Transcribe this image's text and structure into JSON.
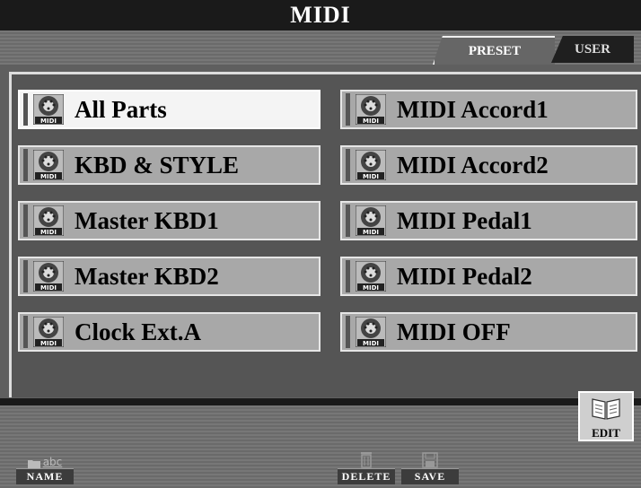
{
  "title": "MIDI",
  "tabs": [
    {
      "label": "PRESET",
      "active": true
    },
    {
      "label": "USER",
      "active": false
    }
  ],
  "items": [
    {
      "label": "All Parts",
      "selected": true,
      "icon": "midi-icon"
    },
    {
      "label": "KBD & STYLE",
      "selected": false,
      "icon": "midi-icon"
    },
    {
      "label": "Master KBD1",
      "selected": false,
      "icon": "midi-icon"
    },
    {
      "label": "Master KBD2",
      "selected": false,
      "icon": "midi-icon"
    },
    {
      "label": "Clock Ext.A",
      "selected": false,
      "icon": "midi-icon"
    },
    {
      "label": "MIDI Accord1",
      "selected": false,
      "icon": "midi-icon"
    },
    {
      "label": "MIDI Accord2",
      "selected": false,
      "icon": "midi-icon"
    },
    {
      "label": "MIDI Pedal1",
      "selected": false,
      "icon": "midi-icon"
    },
    {
      "label": "MIDI Pedal2",
      "selected": false,
      "icon": "midi-icon"
    },
    {
      "label": "MIDI OFF",
      "selected": false,
      "icon": "midi-icon"
    }
  ],
  "icon_caption": "MIDI",
  "buttons": {
    "name": {
      "label": "NAME",
      "icon_text": "abc",
      "icon": "folder-abc-icon"
    },
    "delete": {
      "label": "DELETE",
      "icon": "trash-icon"
    },
    "save": {
      "label": "SAVE",
      "icon": "floppy-disk-icon"
    },
    "edit": {
      "label": "EDIT",
      "icon": "open-book-icon"
    }
  },
  "colors": {
    "title_bg": "#1a1a1a",
    "item_bg": "#a8a8a8",
    "item_selected_bg": "#f4f4f4",
    "panel_bg": "#555555"
  }
}
